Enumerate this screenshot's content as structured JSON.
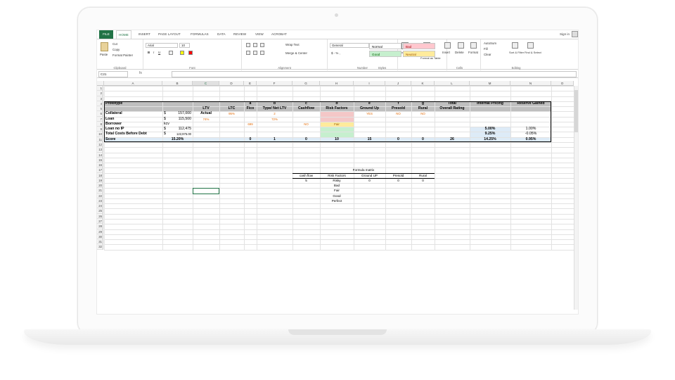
{
  "ribbon": {
    "tabs": [
      "FILE",
      "HOME",
      "INSERT",
      "PAGE LAYOUT",
      "FORMULAS",
      "DATA",
      "REVIEW",
      "VIEW",
      "ACROBAT"
    ],
    "sign_in": "Sign in",
    "clipboard": {
      "paste": "Paste",
      "cut": "Cut",
      "copy": "Copy",
      "format_painter": "Format Painter",
      "label": "Clipboard"
    },
    "font": {
      "name": "Arial",
      "size": "10",
      "label": "Font"
    },
    "alignment": {
      "wrap": "Wrap Text",
      "merge": "Merge & Center",
      "label": "Alignment"
    },
    "number": {
      "format": "General",
      "symbols": "$ - % ,",
      "label": "Number"
    },
    "styles": {
      "cond": "Conditional Formatting",
      "table": "Format as Table",
      "normal": "Normal",
      "bad": "Bad",
      "good": "Good",
      "neutral": "Neutral",
      "label": "Styles"
    },
    "cells": {
      "insert": "Insert",
      "delete": "Delete",
      "format": "Format",
      "label": "Cells"
    },
    "editing": {
      "autosum": "AutoSum",
      "fill": "Fill",
      "clear": "Clear",
      "sort": "Sort & Filter",
      "find": "Find & Select",
      "label": "Editing"
    }
  },
  "formula_bar": {
    "name_box": "C21",
    "fx": "fx",
    "content": ""
  },
  "columns": [
    "A",
    "B",
    "C",
    "D",
    "E",
    "F",
    "G",
    "H",
    "I",
    "J",
    "K",
    "L",
    "M",
    "N",
    "O"
  ],
  "rows": [
    "1",
    "2",
    "3",
    "4",
    "5",
    "6",
    "7",
    "8",
    "9",
    "10",
    "11",
    "12",
    "13",
    "14",
    "15",
    "16",
    "17",
    "18",
    "19",
    "20",
    "21",
    "22",
    "23",
    "24",
    "25",
    "26",
    "27",
    "28",
    "29",
    "30",
    "31",
    "32"
  ],
  "sheet": {
    "r4": {
      "A": "Prototype",
      "E": "a",
      "F": "b",
      "G": "c",
      "H": "d",
      "I": "e",
      "J": "f",
      "K": "g",
      "L": "Total",
      "M": "Internal Pricing",
      "N": "Reserve Gained"
    },
    "r5": {
      "C": "LTV",
      "D": "LTC",
      "E": "Fico",
      "F": "Type/ Net LTV",
      "G": "Cashflow",
      "H": "Risk Factors",
      "I": "Ground Up",
      "J": "Presold",
      "K": "Rural",
      "L": "Overall Rating"
    },
    "r6": {
      "A": "Collateral",
      "B_cur": "$",
      "B": "157,000",
      "C": "Actual",
      "D": "95%",
      "F": "2",
      "I": "YES",
      "J": "NO",
      "K": "NO"
    },
    "r7": {
      "A": "Loan",
      "B_cur": "$",
      "B": "115,500",
      "C": "74%",
      "F": "72%"
    },
    "r8": {
      "A": "Borrower",
      "B": "kcv",
      "E": "699",
      "G": "NO",
      "H": "Fair"
    },
    "r9": {
      "A": "Loan no IP",
      "B_cur": "$",
      "B": "112,475",
      "M": "5.00%",
      "N": "1.00%"
    },
    "r10": {
      "A": "Total Costs Before Debt",
      "B_cur": "$",
      "B": "122,975.00",
      "M": "9.25%",
      "N": "-0.05%"
    },
    "r11": {
      "A": "Score",
      "B": "15.20%",
      "E": "0",
      "F": "1",
      "G": "0",
      "H": "10",
      "I": "15",
      "J": "0",
      "K": "0",
      "L": "26",
      "M": "14.25%",
      "N": "0.95%"
    }
  },
  "matrix": {
    "title": "Formula matrix",
    "headers": [
      "cash flow",
      "Risk Factors",
      "Ground UP",
      "Presold",
      "Rural"
    ],
    "row19": [
      "5",
      "Risky",
      "0",
      "0",
      "0"
    ],
    "risk_list": [
      "Bad",
      "Fair",
      "Good",
      "Perfect"
    ]
  },
  "colors": {
    "excel_green": "#217346",
    "header_gray": "#bfbfbf",
    "pink": "#f4c7c7",
    "yellow": "#ffeb9c",
    "green": "#c6efce",
    "blue": "#ddebf7",
    "orange": "#f79646"
  }
}
